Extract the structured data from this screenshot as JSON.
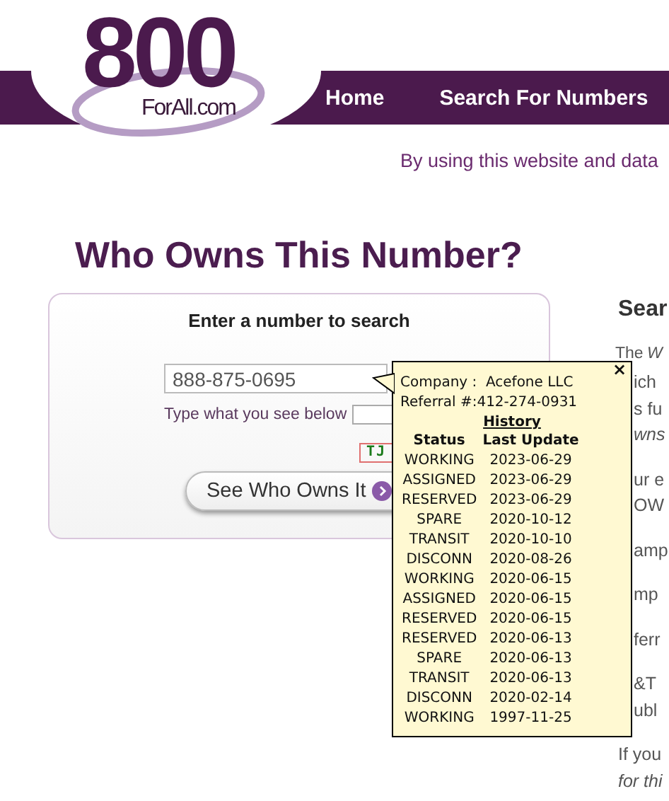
{
  "logo": {
    "number": "800",
    "domain": "ForAll.com"
  },
  "nav": [
    {
      "label": "Home"
    },
    {
      "label": "Search For Numbers"
    }
  ],
  "notice": "By using this website and data",
  "heading": "Who Owns This Number?",
  "search_card": {
    "title": "Enter a number to search",
    "number_field": {
      "value": "888-875-0695"
    },
    "captcha_label": "Type what you see below",
    "captcha_code": "TJ",
    "button": "See Who Owns It"
  },
  "info": {
    "heading": "Sear",
    "intro": "The *W*",
    "covered_paragraphs": [
      [
        {
          "text": "ich",
          "italic": false
        },
        {
          "text": "s fu",
          "italic": false
        },
        {
          "text": "wns",
          "italic": true
        }
      ],
      [
        {
          "text": "ur e",
          "italic": false
        },
        {
          "text": "OW",
          "italic": false
        }
      ],
      [
        {
          "text": "amp",
          "italic": false
        }
      ],
      [
        {
          "text": "mp",
          "italic": false
        }
      ],
      [
        {
          "text": "ferr",
          "italic": false
        }
      ],
      [
        {
          "text": "&T",
          "italic": false
        },
        {
          "text": "ubl",
          "italic": false
        }
      ]
    ],
    "closing": [
      {
        "text": "If you",
        "italic": false
      },
      {
        "text": "for thi",
        "italic": true
      }
    ]
  },
  "popup": {
    "close": "×",
    "company_label": "Company :",
    "company": "Acefone LLC",
    "referral_label": "Referral #:",
    "referral": "412-274-0931",
    "history_title": "History",
    "columns": [
      "Status",
      "Last Update"
    ],
    "rows": [
      [
        "WORKING",
        "2023-06-29"
      ],
      [
        "ASSIGNED",
        "2023-06-29"
      ],
      [
        "RESERVED",
        "2023-06-29"
      ],
      [
        "SPARE",
        "2020-10-12"
      ],
      [
        "TRANSIT",
        "2020-10-10"
      ],
      [
        "DISCONN",
        "2020-08-26"
      ],
      [
        "WORKING",
        "2020-06-15"
      ],
      [
        "ASSIGNED",
        "2020-06-15"
      ],
      [
        "RESERVED",
        "2020-06-15"
      ],
      [
        "RESERVED",
        "2020-06-13"
      ],
      [
        "SPARE",
        "2020-06-13"
      ],
      [
        "TRANSIT",
        "2020-06-13"
      ],
      [
        "DISCONN",
        "2020-02-14"
      ],
      [
        "WORKING",
        "1997-11-25"
      ]
    ]
  }
}
